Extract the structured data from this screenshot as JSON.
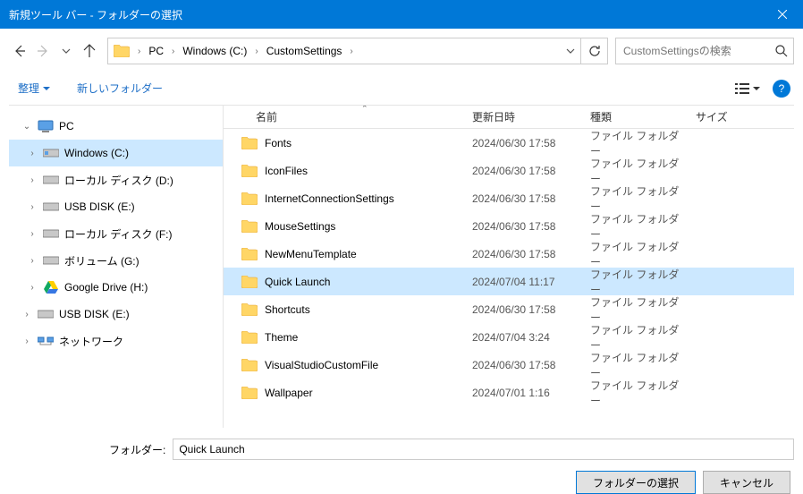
{
  "window": {
    "title": "新規ツール バー - フォルダーの選択"
  },
  "breadcrumb": {
    "seg0": "PC",
    "seg1": "Windows (C:)",
    "seg2": "CustomSettings"
  },
  "search": {
    "placeholder": "CustomSettingsの検索"
  },
  "toolbar": {
    "organize": "整理",
    "newfolder": "新しいフォルダー"
  },
  "tree": {
    "pc": "PC",
    "windows_c": "Windows (C:)",
    "local_d": "ローカル ディスク (D:)",
    "usb_e": "USB DISK (E:)",
    "local_f": "ローカル ディスク (F:)",
    "volume_g": "ボリューム (G:)",
    "gdrive_h": "Google Drive (H:)",
    "usb_e2": "USB DISK (E:)",
    "network": "ネットワーク"
  },
  "columns": {
    "name": "名前",
    "date": "更新日時",
    "type": "種類",
    "size": "サイズ"
  },
  "files": [
    {
      "name": "Fonts",
      "date": "2024/06/30 17:58",
      "type": "ファイル フォルダー",
      "selected": false
    },
    {
      "name": "IconFiles",
      "date": "2024/06/30 17:58",
      "type": "ファイル フォルダー",
      "selected": false
    },
    {
      "name": "InternetConnectionSettings",
      "date": "2024/06/30 17:58",
      "type": "ファイル フォルダー",
      "selected": false
    },
    {
      "name": "MouseSettings",
      "date": "2024/06/30 17:58",
      "type": "ファイル フォルダー",
      "selected": false
    },
    {
      "name": "NewMenuTemplate",
      "date": "2024/06/30 17:58",
      "type": "ファイル フォルダー",
      "selected": false
    },
    {
      "name": "Quick Launch",
      "date": "2024/07/04 11:17",
      "type": "ファイル フォルダー",
      "selected": true
    },
    {
      "name": "Shortcuts",
      "date": "2024/06/30 17:58",
      "type": "ファイル フォルダー",
      "selected": false
    },
    {
      "name": "Theme",
      "date": "2024/07/04 3:24",
      "type": "ファイル フォルダー",
      "selected": false
    },
    {
      "name": "VisualStudioCustomFile",
      "date": "2024/06/30 17:58",
      "type": "ファイル フォルダー",
      "selected": false
    },
    {
      "name": "Wallpaper",
      "date": "2024/07/01 1:16",
      "type": "ファイル フォルダー",
      "selected": false
    }
  ],
  "footer": {
    "folder_label": "フォルダー:",
    "folder_value": "Quick Launch",
    "select_btn": "フォルダーの選択",
    "cancel_btn": "キャンセル"
  }
}
